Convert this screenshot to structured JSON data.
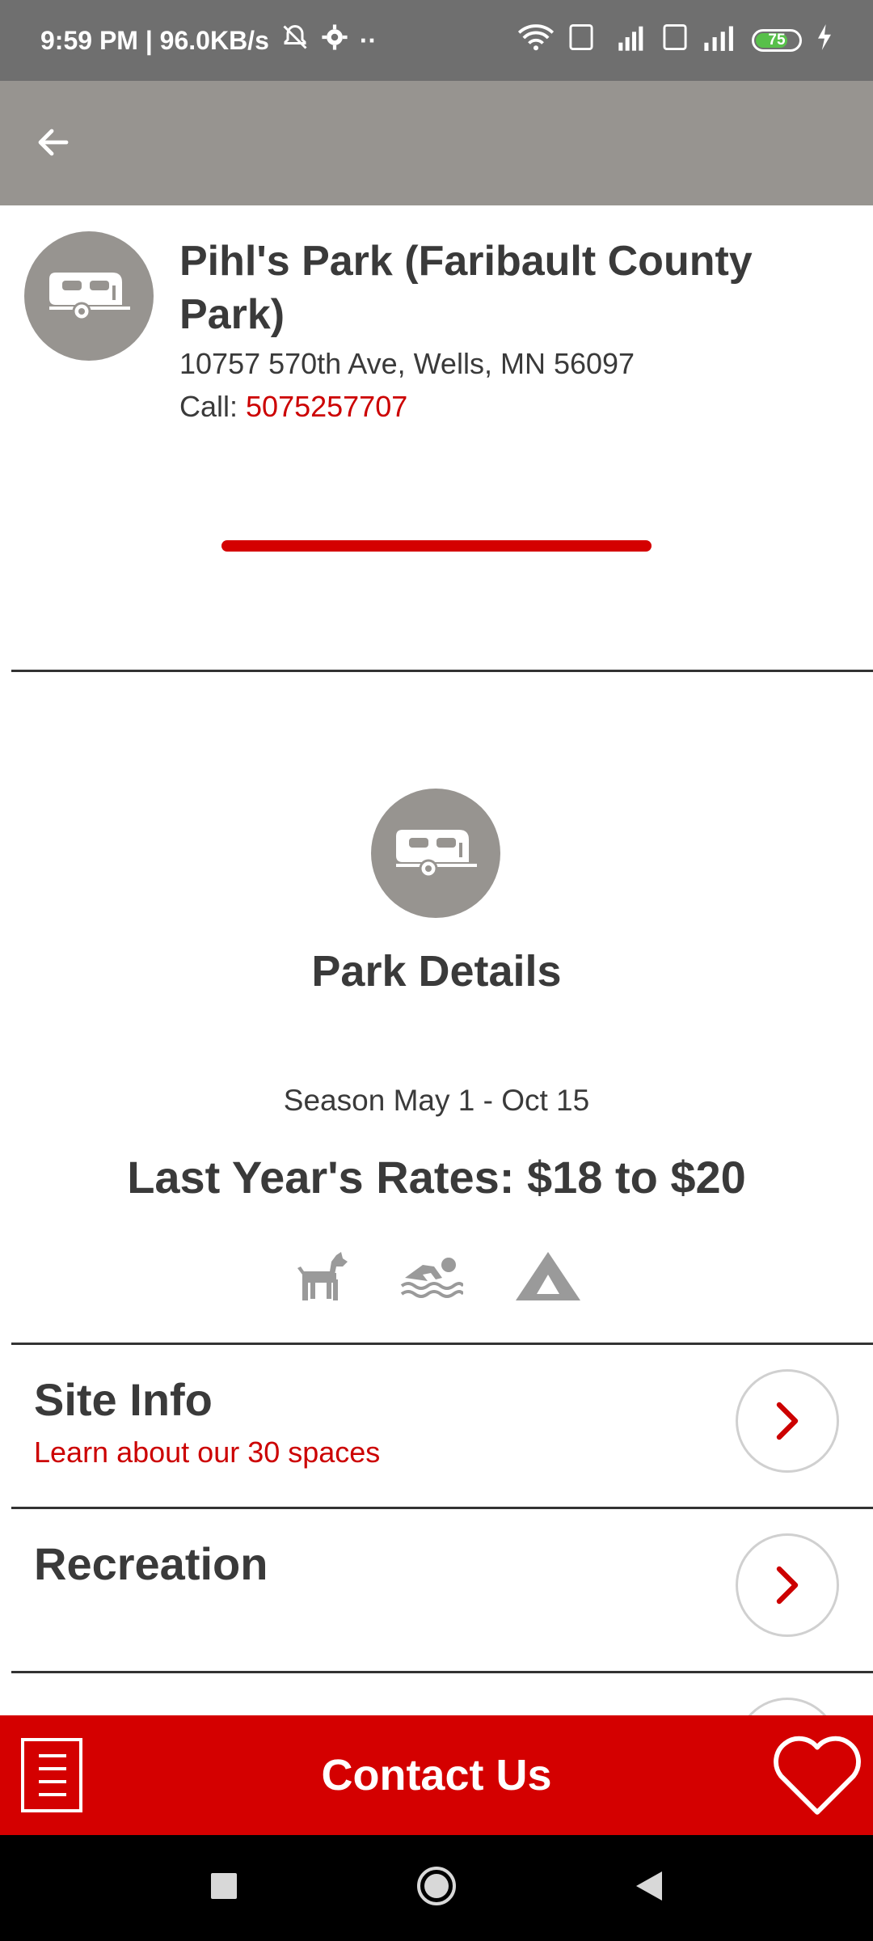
{
  "status_bar": {
    "time_speed": "9:59 PM | 96.0KB/s",
    "dots": "··",
    "battery_level": "75"
  },
  "header": {
    "park_name": "Pihl's Park (Faribault County Park)",
    "address": "10757 570th Ave, Wells, MN 56097",
    "call_label": "Call:",
    "phone": "5075257707"
  },
  "details": {
    "title": "Park Details",
    "season": "Season May 1 - Oct 15",
    "rates": "Last Year's Rates: $18 to $20",
    "amenities": [
      "dog-icon",
      "swimming-icon",
      "tent-icon"
    ]
  },
  "rows": [
    {
      "title": "Site Info",
      "subtitle": "Learn about our 30 spaces"
    },
    {
      "title": "Recreation",
      "subtitle": ""
    }
  ],
  "bottom_bar": {
    "contact_label": "Contact Us"
  },
  "colors": {
    "accent_red": "#d40000",
    "appbar_gray": "#979490",
    "statusbar_gray": "#6f6f6f"
  }
}
